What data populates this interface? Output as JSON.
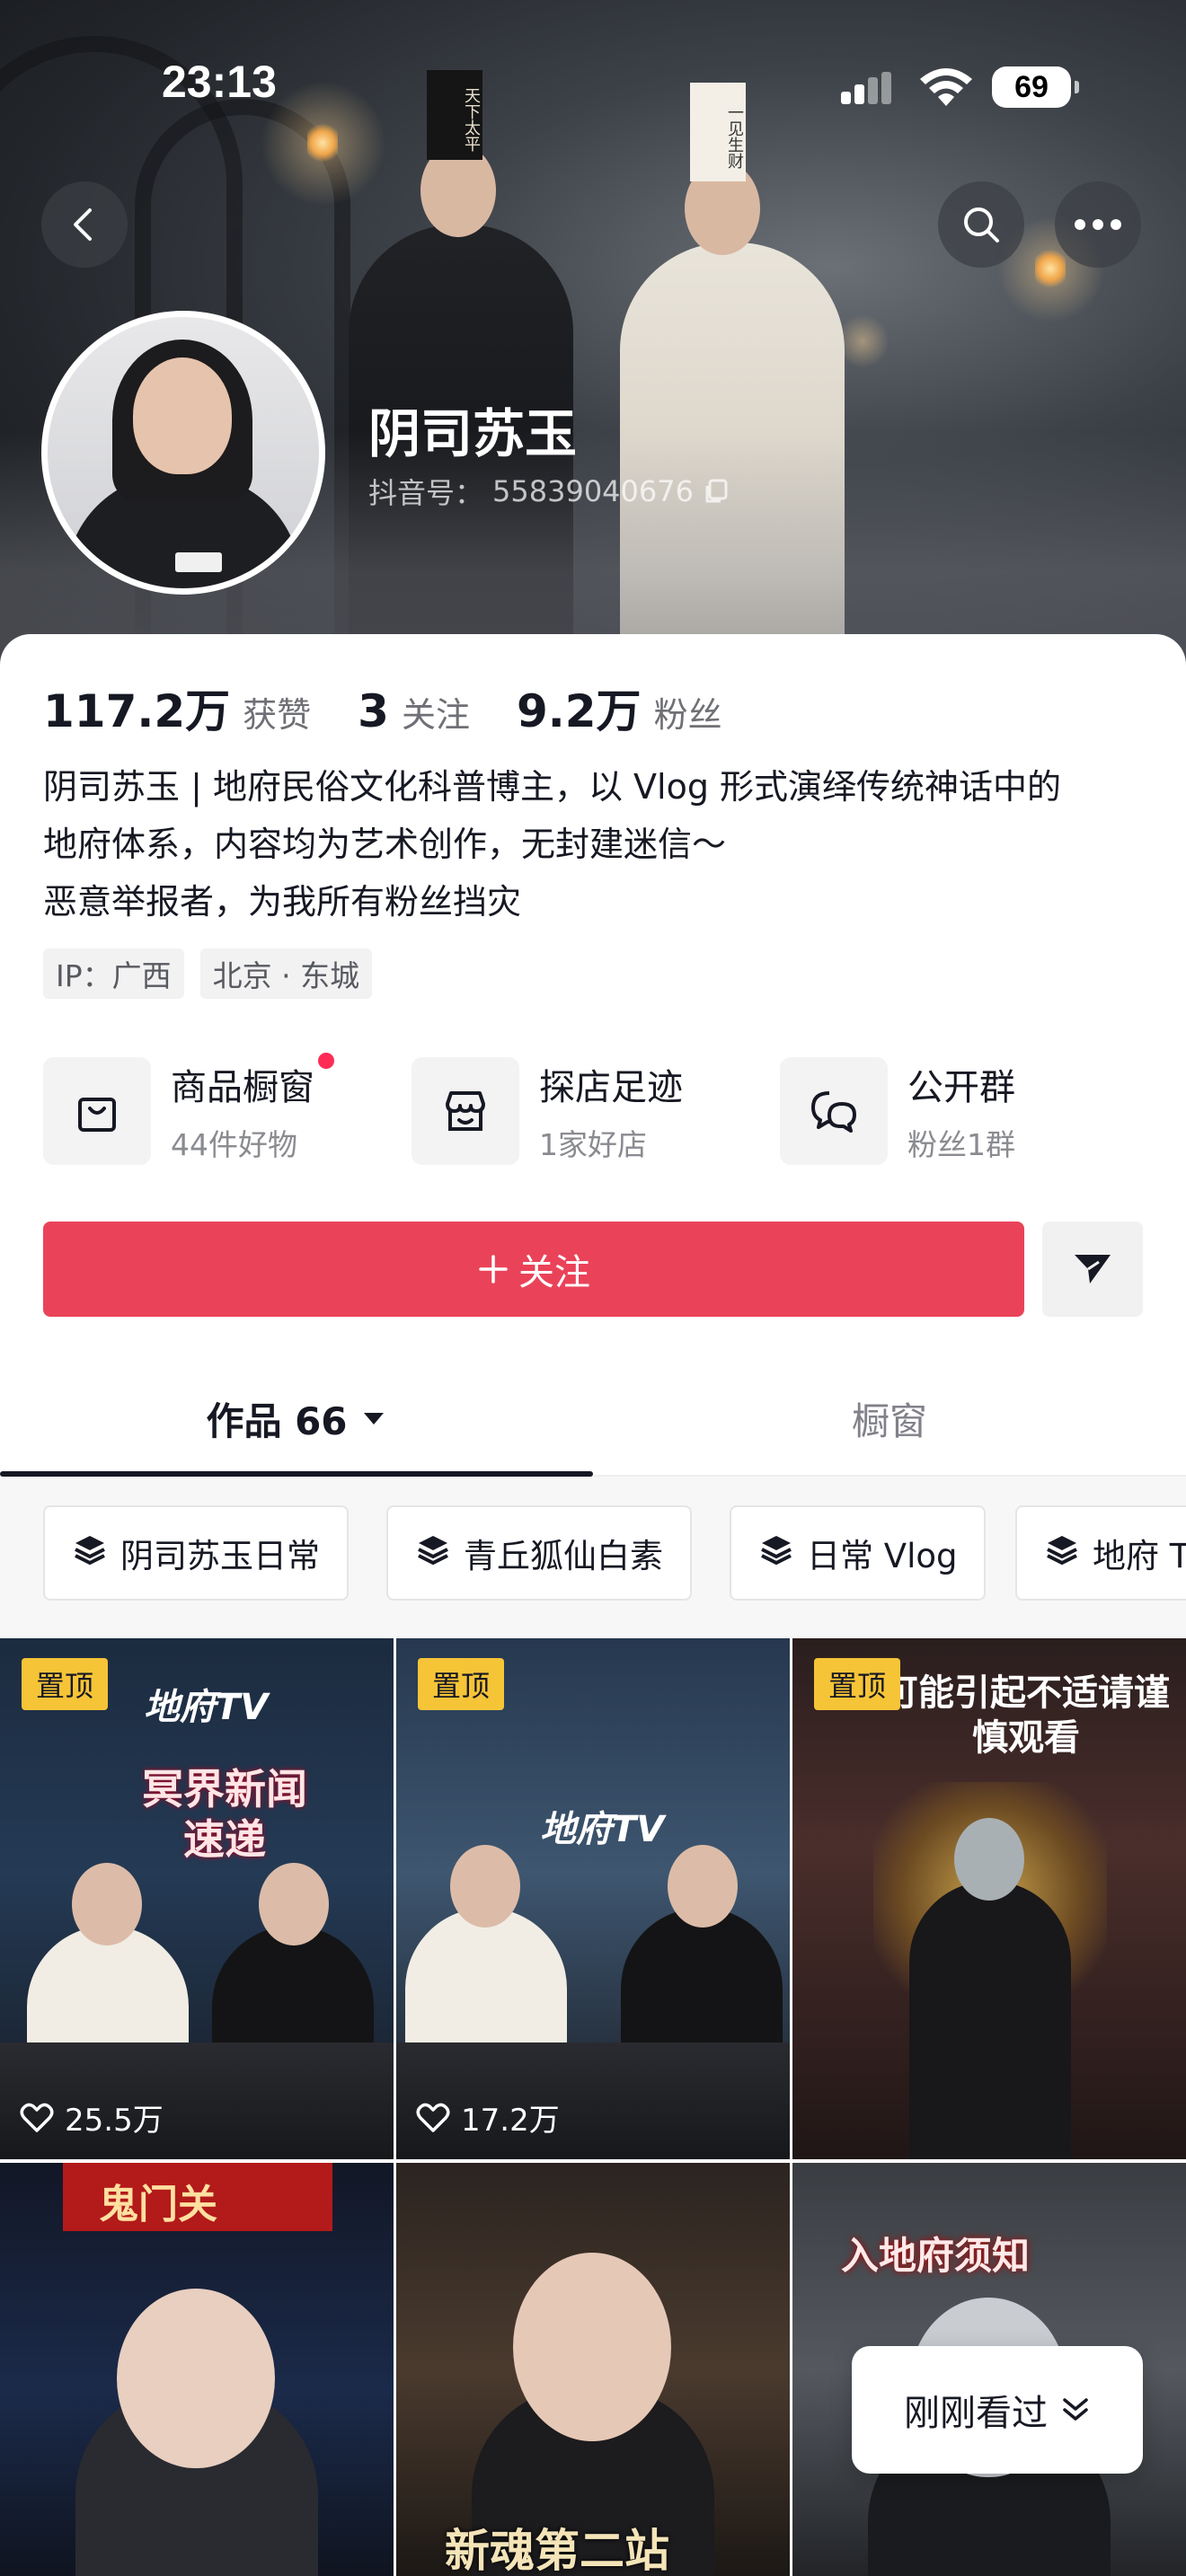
{
  "status_bar": {
    "time": "23:13",
    "battery": "69"
  },
  "header": {
    "display_name": "阴司苏玉",
    "douyin_id_label": "抖音号：",
    "douyin_id": "55839040676",
    "hat_dark_text": "天下太平",
    "hat_light_text": "一见生财"
  },
  "stats": [
    {
      "value": "117.2万",
      "label": "获赞"
    },
    {
      "value": "3",
      "label": "关注"
    },
    {
      "value": "9.2万",
      "label": "粉丝"
    }
  ],
  "bio": {
    "line1": "阴司苏玉 | 地府民俗文化科普博主，以 Vlog 形式演绎传统神话中的",
    "line2": "地府体系，内容均为艺术创作，无封建迷信～",
    "line3": "恶意举报者，为我所有粉丝挡灾"
  },
  "tags": [
    "IP：广西",
    "北京 · 东城"
  ],
  "services": [
    {
      "title": "商品橱窗",
      "subtitle": "44件好物",
      "icon": "bag-icon"
    },
    {
      "title": "探店足迹",
      "subtitle": "1家好店",
      "icon": "store-icon"
    },
    {
      "title": "公开群",
      "subtitle": "粉丝1群",
      "icon": "chat-bubbles-icon"
    }
  ],
  "follow_button": {
    "label": "关注"
  },
  "tabs": {
    "works": "作品 66",
    "window": "橱窗"
  },
  "collections": [
    "阴司苏玉日常",
    "青丘狐仙白素",
    "日常 Vlog",
    "地府 T"
  ],
  "grid": {
    "pin_label": "置顶",
    "items": [
      {
        "title": "地府TV",
        "overlay": "冥界新闻速递",
        "likes": "25.5万",
        "pinned": true
      },
      {
        "title": "地府TV",
        "likes": "17.2万",
        "pinned": true
      },
      {
        "overlay": "可能引起不适请谨慎观看",
        "pinned": true
      },
      {
        "overlay": "鬼门关"
      },
      {
        "overlay": "新魂第二站"
      },
      {
        "overlay": "入地府须知"
      }
    ]
  },
  "recent_button": {
    "label": "刚刚看过"
  },
  "colors": {
    "follow": "#ea4359",
    "pin": "#f6c437",
    "dot": "#fe2c55"
  }
}
